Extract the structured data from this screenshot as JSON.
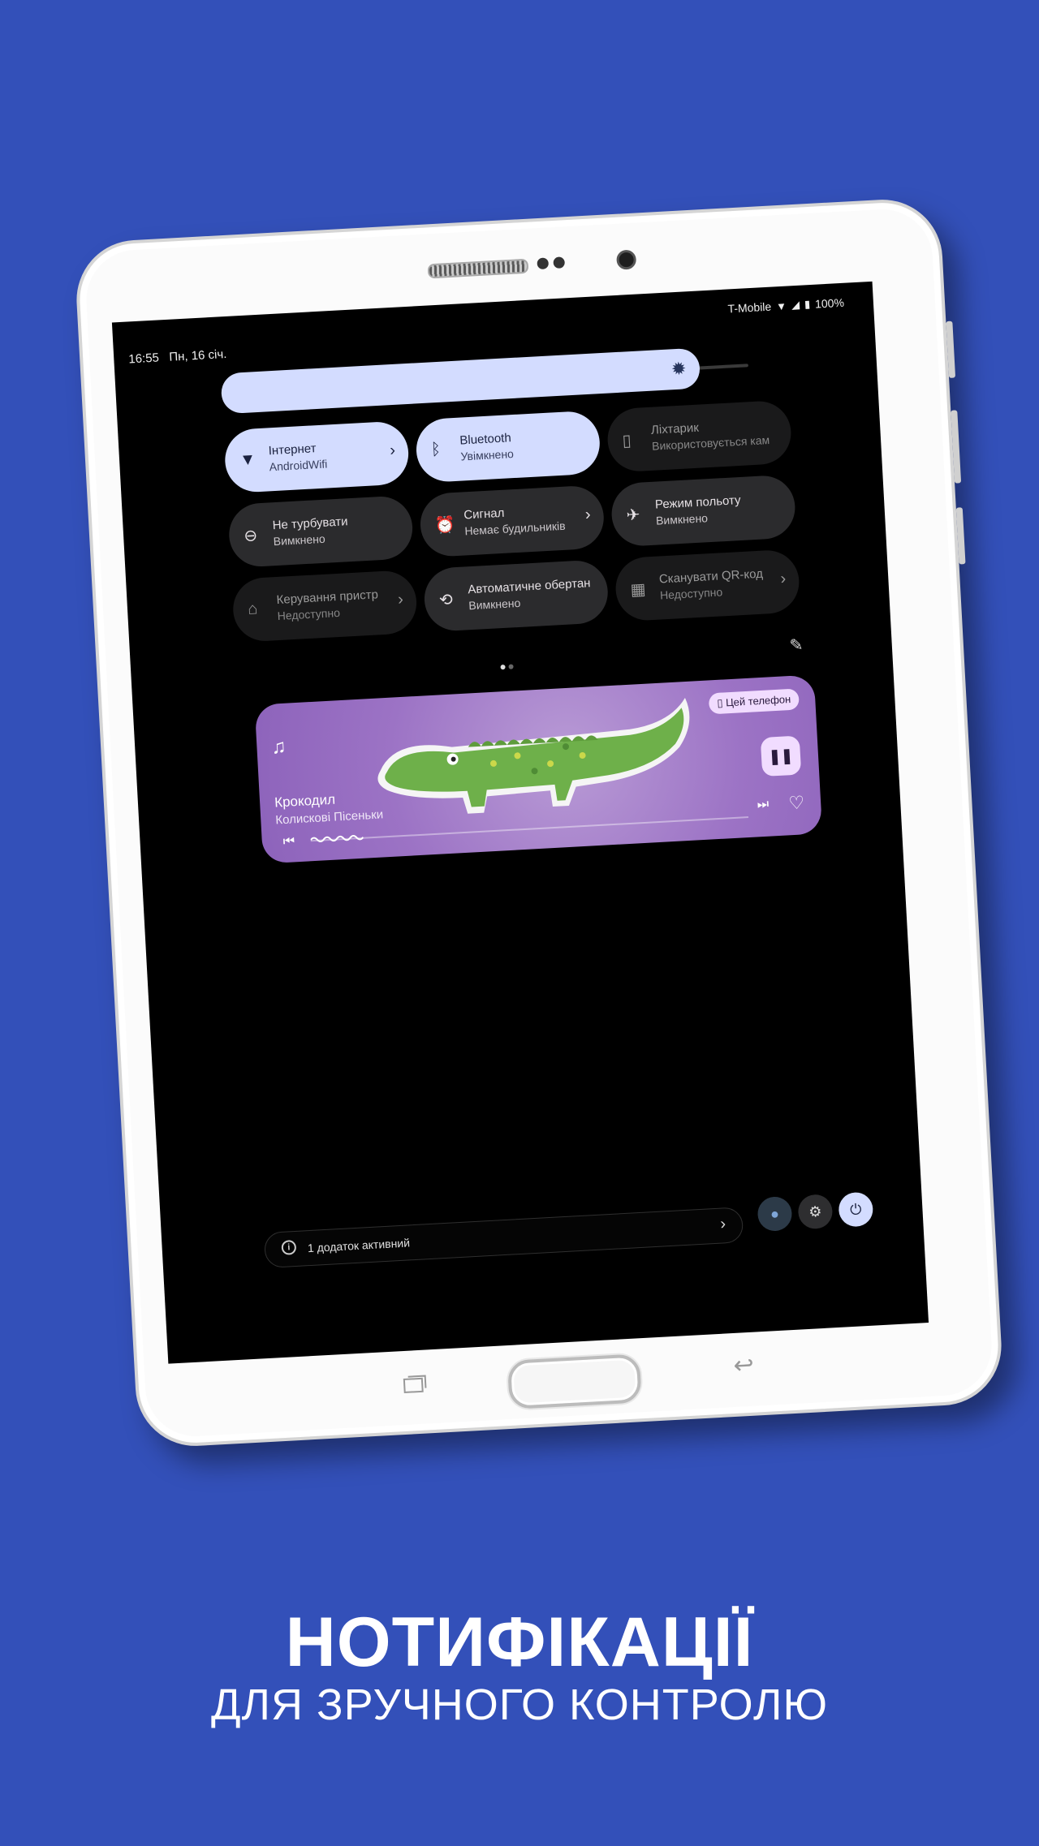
{
  "status": {
    "time": "16:55",
    "date": "Пн, 16 січ.",
    "carrier": "T-Mobile",
    "battery": "100%"
  },
  "tiles": [
    {
      "title": "Інтернет",
      "subtitle": "AndroidWifi",
      "icon": "wifi-icon",
      "state": "on",
      "chevron": "›"
    },
    {
      "title": "Bluetooth",
      "subtitle": "Увімкнено",
      "icon": "bluetooth-icon",
      "state": "on"
    },
    {
      "title": "Ліхтарик",
      "subtitle": "Використовується кам",
      "icon": "flashlight-icon",
      "state": "dim"
    },
    {
      "title": "Не турбувати",
      "subtitle": "Вимкнено",
      "icon": "dnd-icon",
      "state": "off"
    },
    {
      "title": "Сигнал",
      "subtitle": "Немає будильників",
      "icon": "alarm-icon",
      "state": "off",
      "chevron": "›"
    },
    {
      "title": "Режим польоту",
      "subtitle": "Вимкнено",
      "icon": "airplane-icon",
      "state": "off"
    },
    {
      "title": "Керування пристр",
      "subtitle": "Недоступно",
      "icon": "home-icon",
      "state": "dim",
      "chevron": "›"
    },
    {
      "title": "Автоматичне обертан",
      "subtitle": "Вимкнено",
      "icon": "rotate-icon",
      "state": "off"
    },
    {
      "title": "Сканувати QR-код",
      "subtitle": "Недоступно",
      "icon": "qr-icon",
      "state": "dim",
      "chevron": "›"
    }
  ],
  "media": {
    "title": "Крокодил",
    "artist": "Колискові Пісеньки",
    "device": "Цей телефон",
    "progress": 0.12
  },
  "footer": {
    "text": "1 додаток активний"
  },
  "headline": "НОТИФІКАЦІЇ",
  "subline": "ДЛЯ ЗРУЧНОГО КОНТРОЛЮ",
  "colors": {
    "background": "#3350b9",
    "tile_on": "#d3dcff",
    "tile_off": "#2b2b2d",
    "media": "#9c73c5"
  }
}
